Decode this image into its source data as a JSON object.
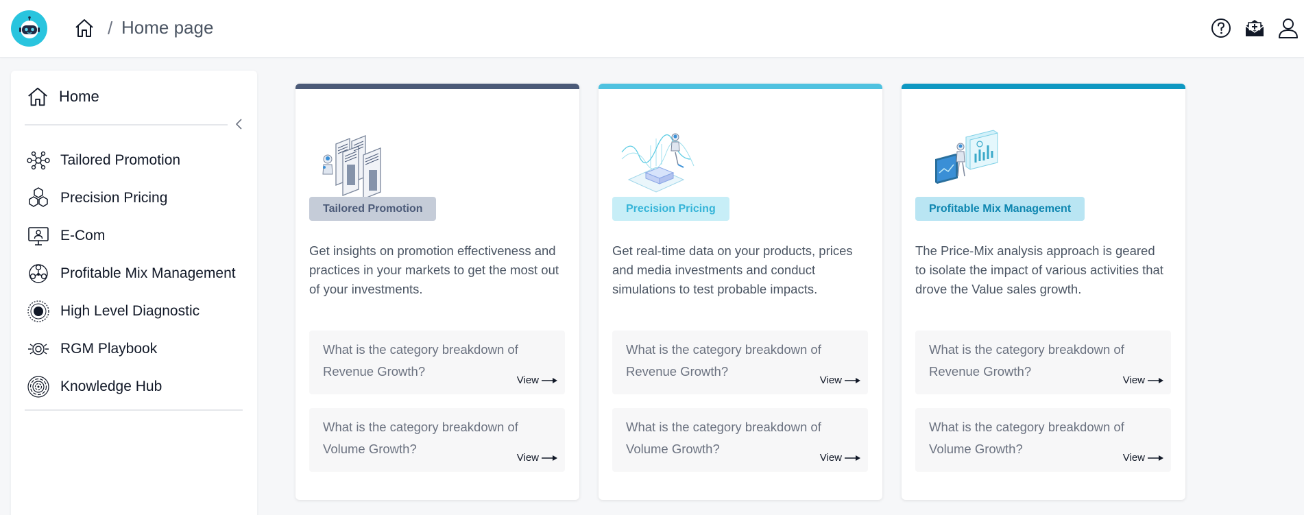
{
  "header": {
    "breadcrumb_separator": "/",
    "breadcrumb_current": "Home page"
  },
  "sidebar": {
    "home_label": "Home",
    "items": [
      {
        "label": "Tailored Promotion",
        "icon": "network-nodes-icon"
      },
      {
        "label": "Precision Pricing",
        "icon": "hexagons-icon"
      },
      {
        "label": "E-Com",
        "icon": "monitor-user-icon"
      },
      {
        "label": "Profitable Mix Management",
        "icon": "mix-hub-icon"
      },
      {
        "label": "High Level Diagnostic",
        "icon": "target-dot-icon"
      },
      {
        "label": "RGM Playbook",
        "icon": "playbook-radar-icon"
      },
      {
        "label": "Knowledge Hub",
        "icon": "fingerprint-rings-icon"
      }
    ]
  },
  "cards": [
    {
      "tag": "Tailored Promotion",
      "accent": "#4b5a78",
      "tag_bg": "#c5ccd8",
      "tag_color": "#4b5a78",
      "description": "Get insights on promotion effectiveness and practices in your markets to get the most out of your investments.",
      "questions": [
        {
          "text": "What is the category breakdown of Revenue Growth?",
          "action": "View"
        },
        {
          "text": "What is the category breakdown of Volume Growth?",
          "action": "View"
        }
      ]
    },
    {
      "tag": "Precision Pricing",
      "accent": "#4fc2e0",
      "tag_bg": "#c7eef7",
      "tag_color": "#35b4d8",
      "description": "Get real-time data on your products, prices and media investments and conduct simulations to test probable impacts.",
      "questions": [
        {
          "text": "What is the category breakdown of Revenue Growth?",
          "action": "View"
        },
        {
          "text": "What is the category breakdown of Volume Growth?",
          "action": "View"
        }
      ]
    },
    {
      "tag": "Profitable Mix Management",
      "accent": "#0e98c2",
      "tag_bg": "#b9e5f3",
      "tag_color": "#0e86b0",
      "description": "The Price-Mix analysis approach is geared to isolate the impact of various activities that drove the Value sales growth.",
      "questions": [
        {
          "text": "What is the category breakdown of Revenue Growth?",
          "action": "View"
        },
        {
          "text": "What is the category breakdown of Volume Growth?",
          "action": "View"
        }
      ]
    }
  ]
}
